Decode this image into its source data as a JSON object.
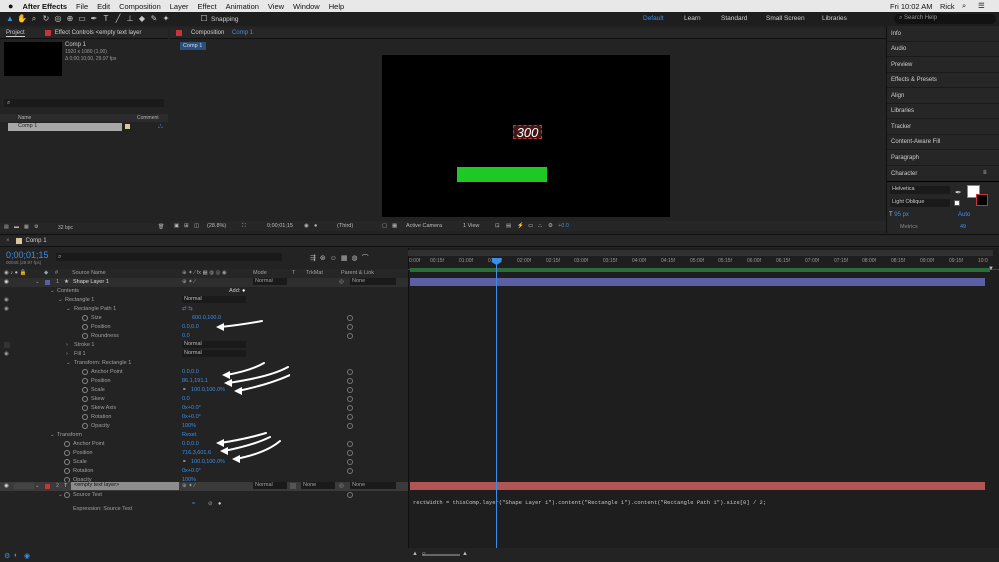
{
  "menubar": {
    "app": "After Effects",
    "items": [
      "File",
      "Edit",
      "Composition",
      "Layer",
      "Effect",
      "Animation",
      "View",
      "Window",
      "Help"
    ],
    "clock": "Fri 10:02 AM",
    "user": "Rick"
  },
  "toolbar": {
    "snapping": "Snapping",
    "workspaces": [
      "Default",
      "Learn",
      "Standard",
      "Small Screen",
      "Libraries"
    ],
    "search_placeholder": "Search Help"
  },
  "project": {
    "tab": "Project",
    "effect_controls": "Effect Controls <empty text layer",
    "comp_name": "Comp 1",
    "comp_info1": "1920 x 1080 (1.00)",
    "comp_info2": "Δ 0;00;10;00, 29.97 fps",
    "col_name": "Name",
    "col_comment": "Comment",
    "item": "Comp 1",
    "bpc": "32 bpc"
  },
  "viewer": {
    "tab_prefix": "Composition",
    "tab_comp": "Comp 1",
    "crumb": "Comp 1",
    "text_value": "300",
    "zoom": "(28.8%)",
    "time": "0;00;01;15",
    "resolution": "(Third)",
    "camera": "Active Camera",
    "views": "1 View",
    "exposure": "+0.0"
  },
  "right_panel": {
    "items": [
      "Info",
      "Audio",
      "Preview",
      "Effects & Presets",
      "Align",
      "Libraries",
      "Tracker",
      "Content-Aware Fill",
      "Paragraph"
    ],
    "character_title": "Character",
    "font": "Helvetica",
    "style": "Light Oblique",
    "size": "95 px",
    "leading": "Auto",
    "metrics": "Metrics",
    "tracking": "49"
  },
  "timeline": {
    "tab": "Comp 1",
    "time": "0;00;01;15",
    "frame": "00045 (29.97 fps)",
    "col_source": "Source Name",
    "col_mode": "Mode",
    "col_t": "T",
    "col_trkmat": "TrkMat",
    "col_parent": "Parent & Link",
    "layer1": {
      "num": "1",
      "name": "Shape Layer 1",
      "mode": "Normal",
      "parent": "None"
    },
    "contents": "Contents",
    "add": "Add:",
    "rect1": "Rectangle 1",
    "rect_mode": "Normal",
    "rectpath": "Rectangle Path 1",
    "size_label": "Size",
    "size_val": "600.0,100.0",
    "position_label": "Position",
    "pos_val": "0.0,0.0",
    "roundness_label": "Roundness",
    "roundness_val": "0.0",
    "stroke": "Stroke 1",
    "stroke_mode": "Normal",
    "fill": "Fill 1",
    "fill_mode": "Normal",
    "transform_rect": "Transform: Rectangle 1",
    "anchor_label": "Anchor Point",
    "anchor_val": "0.0,0.0",
    "tpos_val": "86.1,191.1",
    "scale_label": "Scale",
    "scale_val": "100.0,100.0%",
    "skew_label": "Skew",
    "skew_val": "0.0",
    "skewaxis_label": "Skew Axis",
    "skewaxis_val": "0x+0.0°",
    "rotation_label": "Rotation",
    "rotation_val": "0x+0.0°",
    "opacity_label": "Opacity",
    "opacity_val": "100%",
    "transform": "Transform",
    "reset": "Reset",
    "l_anchor_val": "0.0,0.0",
    "l_pos_val": "716.3,601.6",
    "l_scale_val": "100.0,100.0%",
    "l_rot_val": "0x+0.0°",
    "l_opacity_val": "100%",
    "layer2": {
      "num": "2",
      "name": "<empty text layer>",
      "mode": "Normal",
      "trkmat": "None",
      "parent": "None"
    },
    "source_text": "Source Text",
    "expression_label": "Expression: Source Text",
    "expression": "rectWidth = thisComp.layer(\"Shape Layer 1\").content(\"Rectangle 1\").content(\"Rectangle Path 1\").size[0] / 2;",
    "ruler": [
      "0:00f",
      "00:15f",
      "01:00f",
      "01:15f",
      "02:00f",
      "02:15f",
      "03:00f",
      "03:15f",
      "04:00f",
      "04:15f",
      "05:00f",
      "05:15f",
      "06:00f",
      "06:15f",
      "07:00f",
      "07:15f",
      "08:00f",
      "08:15f",
      "09:00f",
      "09:15f",
      "10:0"
    ]
  },
  "colors": {
    "green_bar": "#1ec825",
    "accent": "#3d8ee8",
    "layer1_bar": "#5d5fa6",
    "layer2_bar": "#b05454"
  }
}
